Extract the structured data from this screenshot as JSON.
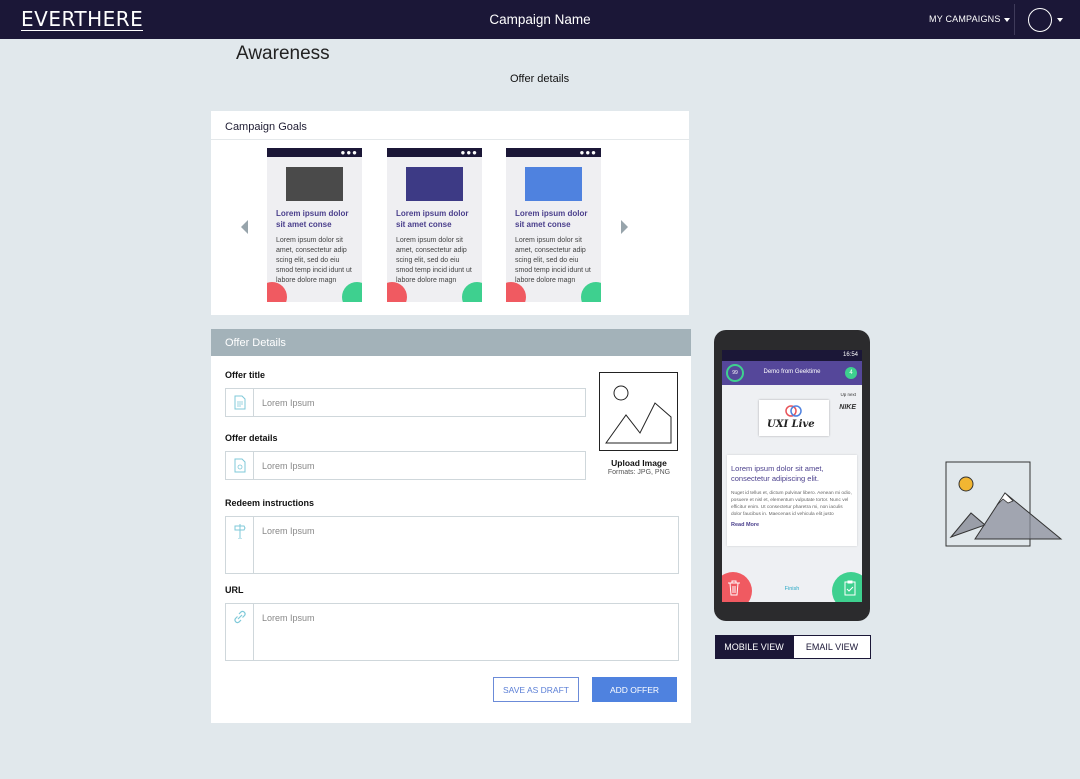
{
  "header": {
    "logo": "EVERTHERE",
    "campaign_name": "Campaign Name",
    "my_campaigns": "MY CAMPAIGNS"
  },
  "page": {
    "title": "Awareness",
    "subtitle": "Offer details"
  },
  "campaign_goals": {
    "heading": "Campaign Goals",
    "cards": [
      {
        "title": "Lorem ipsum dolor sit amet conse",
        "body": "Lorem ipsum dolor sit amet, consectetur adip scing elit, sed do eiu smod temp incid idunt ut labore dolore magn",
        "image_color": "#4a4a4a"
      },
      {
        "title": "Lorem ipsum dolor sit amet conse",
        "body": "Lorem ipsum dolor sit amet, consectetur adip scing elit, sed do eiu smod temp incid idunt ut labore dolore magn",
        "image_color": "#3d3a85"
      },
      {
        "title": "Lorem ipsum dolor sit amet conse",
        "body": "Lorem ipsum dolor sit amet, consectetur adip scing elit, sed do eiu smod temp incid idunt ut labore dolore magn",
        "image_color": "#4f82df"
      }
    ]
  },
  "offer_details": {
    "heading": "Offer Details",
    "offer_title": {
      "label": "Offer title",
      "placeholder": "Lorem Ipsum"
    },
    "offer_details": {
      "label": "Offer details",
      "placeholder": "Lorem Ipsum"
    },
    "redeem": {
      "label": "Redeem instructions",
      "placeholder": "Lorem Ipsum"
    },
    "url": {
      "label": "URL",
      "placeholder": "Lorem Ipsum"
    },
    "upload": {
      "label": "Upload Image",
      "formats": "Formats: JPG, PNG"
    },
    "save_draft": "SAVE AS DRAFT",
    "add_offer": "ADD OFFER"
  },
  "phone": {
    "time": "16:54",
    "ring_value": "99",
    "app_title": "Demo from Geektime",
    "badge": "4",
    "up_next": "Up next",
    "logo_text": "UXI Live",
    "next_brand": "NIKE",
    "content_title": "Lorem ipsum dolor sit amet, consectetur adipiscing elit.",
    "content_body": "Nuget id tellus et, dictum pulvinar libero. Aenean mi odio, posuere et nisl et, elementum vulputate tortor. Nunc vel efficitur enim. Ut consectetur pharetra mi, non iaculis dolor faucibus in. Maecenas id vehicula elit justo",
    "read_more": "Read More",
    "finish": "Finish"
  },
  "view_toggle": {
    "mobile": "MOBILE VIEW",
    "email": "EMAIL VIEW"
  },
  "colors": {
    "navy": "#1b1737",
    "accent_blue": "#4f82df",
    "purple": "#55479a",
    "red": "#f05a61",
    "green": "#3ed08f"
  }
}
